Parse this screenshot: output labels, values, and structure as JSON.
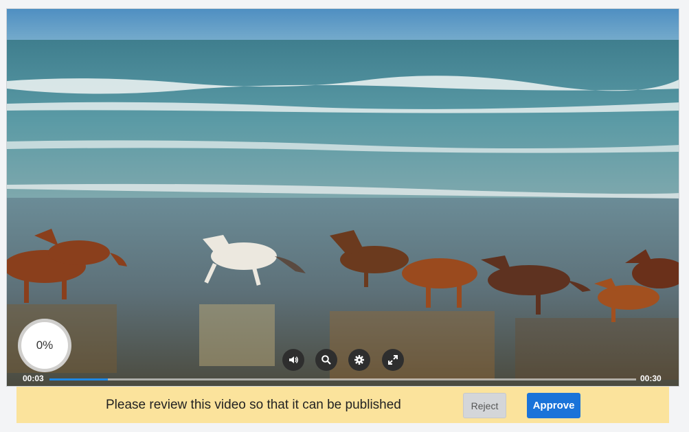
{
  "video": {
    "progress_percent": "0%",
    "current_time": "00:03",
    "duration": "00:30",
    "played_fraction": 0.1,
    "controls": [
      {
        "name": "volume-button",
        "icon": "volume-icon"
      },
      {
        "name": "zoom-button",
        "icon": "search-icon"
      },
      {
        "name": "settings-button",
        "icon": "gear-icon"
      },
      {
        "name": "fullscreen-button",
        "icon": "expand-icon"
      }
    ],
    "scene_description_colors": {
      "sky": "#5f9cc8",
      "sea": "#4d8e9a",
      "sand": "#6c7f86",
      "horse_brown": "#8a4420",
      "horse_white": "#e9e6de"
    }
  },
  "review": {
    "message": "Please review this video so that it can be published",
    "reject_label": "Reject",
    "approve_label": "Approve",
    "bar_color": "#fbe39c",
    "approve_color": "#1a73d9"
  }
}
